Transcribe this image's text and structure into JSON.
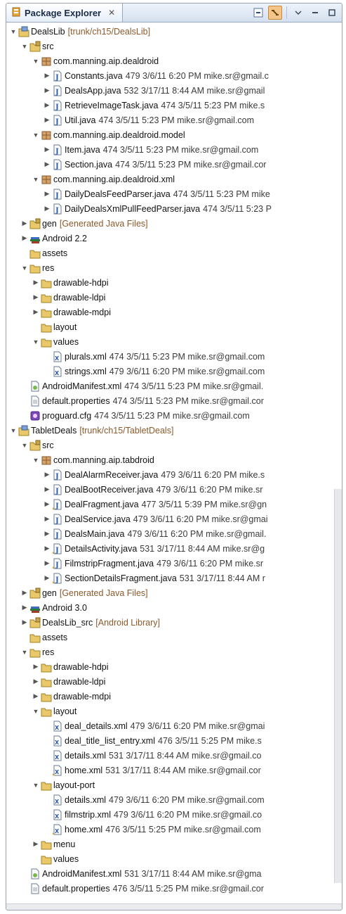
{
  "panel": {
    "title": "Package Explorer",
    "close_glyph": "✕",
    "toolbar": [
      "collapse-all-icon",
      "link-with-editor-icon",
      "view-menu-icon",
      "minimize-icon",
      "maximize-icon"
    ]
  },
  "tree": [
    {
      "d": 0,
      "a": "open",
      "icon": "project",
      "name": "DealsLib",
      "dec": "[trunk/ch15/DealsLib]",
      "decColor": "brown"
    },
    {
      "d": 1,
      "a": "open",
      "icon": "srcfolder",
      "name": "src",
      "dec": ""
    },
    {
      "d": 2,
      "a": "open",
      "icon": "package",
      "name": "com.manning.aip.dealdroid",
      "dec": ""
    },
    {
      "d": 3,
      "a": "closed",
      "icon": "java",
      "name": "Constants.java",
      "dec": "479  3/6/11 6:20 PM  mike.sr@gmail.c"
    },
    {
      "d": 3,
      "a": "closed",
      "icon": "java",
      "name": "DealsApp.java",
      "dec": "532  3/17/11 8:44 AM  mike.sr@gmail"
    },
    {
      "d": 3,
      "a": "closed",
      "icon": "java",
      "name": "RetrieveImageTask.java",
      "dec": "474  3/5/11 5:23 PM  mike.s"
    },
    {
      "d": 3,
      "a": "closed",
      "icon": "java",
      "name": "Util.java",
      "dec": "474  3/5/11 5:23 PM  mike.sr@gmail.com"
    },
    {
      "d": 2,
      "a": "open",
      "icon": "package",
      "name": "com.manning.aip.dealdroid.model",
      "dec": ""
    },
    {
      "d": 3,
      "a": "closed",
      "icon": "java",
      "name": "Item.java",
      "dec": "474  3/5/11 5:23 PM  mike.sr@gmail.com"
    },
    {
      "d": 3,
      "a": "closed",
      "icon": "java",
      "name": "Section.java",
      "dec": "474  3/5/11 5:23 PM  mike.sr@gmail.cor"
    },
    {
      "d": 2,
      "a": "open",
      "icon": "package",
      "name": "com.manning.aip.dealdroid.xml",
      "dec": ""
    },
    {
      "d": 3,
      "a": "closed",
      "icon": "java",
      "name": "DailyDealsFeedParser.java",
      "dec": "474  3/5/11 5:23 PM  mike"
    },
    {
      "d": 3,
      "a": "closed",
      "icon": "java",
      "name": "DailyDealsXmlPullFeedParser.java",
      "dec": "474  3/5/11 5:23 P"
    },
    {
      "d": 1,
      "a": "closed",
      "icon": "srcfolder",
      "name": "gen",
      "dec": "[Generated Java Files]",
      "decColor": "brown"
    },
    {
      "d": 1,
      "a": "closed",
      "icon": "library",
      "name": "Android 2.2",
      "dec": ""
    },
    {
      "d": 1,
      "a": "none",
      "icon": "folder",
      "name": "assets",
      "dec": ""
    },
    {
      "d": 1,
      "a": "open",
      "icon": "folder",
      "name": "res",
      "dec": ""
    },
    {
      "d": 2,
      "a": "closed",
      "icon": "folder",
      "name": "drawable-hdpi",
      "dec": ""
    },
    {
      "d": 2,
      "a": "closed",
      "icon": "folder",
      "name": "drawable-ldpi",
      "dec": ""
    },
    {
      "d": 2,
      "a": "closed",
      "icon": "folder",
      "name": "drawable-mdpi",
      "dec": ""
    },
    {
      "d": 2,
      "a": "none",
      "icon": "folder",
      "name": "layout",
      "dec": ""
    },
    {
      "d": 2,
      "a": "open",
      "icon": "folder",
      "name": "values",
      "dec": ""
    },
    {
      "d": 3,
      "a": "none",
      "icon": "xml",
      "name": "plurals.xml",
      "dec": "474  3/5/11 5:23 PM  mike.sr@gmail.com"
    },
    {
      "d": 3,
      "a": "none",
      "icon": "xml",
      "name": "strings.xml",
      "dec": "479  3/6/11 6:20 PM  mike.sr@gmail.com"
    },
    {
      "d": 1,
      "a": "none",
      "icon": "manifest",
      "name": "AndroidManifest.xml",
      "dec": "474  3/5/11 5:23 PM  mike.sr@gmail."
    },
    {
      "d": 1,
      "a": "none",
      "icon": "file",
      "name": "default.properties",
      "dec": "474  3/5/11 5:23 PM  mike.sr@gmail.cor"
    },
    {
      "d": 1,
      "a": "none",
      "icon": "proguard",
      "name": "proguard.cfg",
      "dec": "474  3/5/11 5:23 PM  mike.sr@gmail.com"
    },
    {
      "d": 0,
      "a": "open",
      "icon": "project",
      "name": "TabletDeals",
      "dec": "[trunk/ch15/TabletDeals]",
      "decColor": "brown"
    },
    {
      "d": 1,
      "a": "open",
      "icon": "srcfolder",
      "name": "src",
      "dec": ""
    },
    {
      "d": 2,
      "a": "open",
      "icon": "package",
      "name": "com.manning.aip.tabdroid",
      "dec": ""
    },
    {
      "d": 3,
      "a": "closed",
      "icon": "java",
      "name": "DealAlarmReceiver.java",
      "dec": "479  3/6/11 6:20 PM  mike.s"
    },
    {
      "d": 3,
      "a": "closed",
      "icon": "java",
      "name": "DealBootReceiver.java",
      "dec": "479  3/6/11 6:20 PM  mike.sr"
    },
    {
      "d": 3,
      "a": "closed",
      "icon": "javaw",
      "name": "DealFragment.java",
      "dec": "477  3/5/11 5:39 PM  mike.sr@gn"
    },
    {
      "d": 3,
      "a": "closed",
      "icon": "java",
      "name": "DealService.java",
      "dec": "479  3/6/11 6:20 PM  mike.sr@gmai"
    },
    {
      "d": 3,
      "a": "closed",
      "icon": "java",
      "name": "DealsMain.java",
      "dec": "479  3/6/11 6:20 PM  mike.sr@gmail."
    },
    {
      "d": 3,
      "a": "closed",
      "icon": "javaw",
      "name": "DetailsActivity.java",
      "dec": "531  3/17/11 8:44 AM  mike.sr@g"
    },
    {
      "d": 3,
      "a": "closed",
      "icon": "javaw",
      "name": "FilmstripFragment.java",
      "dec": "479  3/6/11 6:20 PM  mike.sr"
    },
    {
      "d": 3,
      "a": "closed",
      "icon": "javaw",
      "name": "SectionDetailsFragment.java",
      "dec": "531  3/17/11 8:44 AM  r"
    },
    {
      "d": 1,
      "a": "closed",
      "icon": "srcfolder",
      "name": "gen",
      "dec": "[Generated Java Files]",
      "decColor": "brown"
    },
    {
      "d": 1,
      "a": "closed",
      "icon": "library",
      "name": "Android 3.0",
      "dec": ""
    },
    {
      "d": 1,
      "a": "closed",
      "icon": "srcfolder",
      "name": "DealsLib_src",
      "dec": "[Android Library]",
      "decColor": "brown"
    },
    {
      "d": 1,
      "a": "none",
      "icon": "folder",
      "name": "assets",
      "dec": ""
    },
    {
      "d": 1,
      "a": "open",
      "icon": "folder",
      "name": "res",
      "dec": ""
    },
    {
      "d": 2,
      "a": "closed",
      "icon": "folder",
      "name": "drawable-hdpi",
      "dec": ""
    },
    {
      "d": 2,
      "a": "closed",
      "icon": "folder",
      "name": "drawable-ldpi",
      "dec": ""
    },
    {
      "d": 2,
      "a": "closed",
      "icon": "folder",
      "name": "drawable-mdpi",
      "dec": ""
    },
    {
      "d": 2,
      "a": "open",
      "icon": "folder",
      "name": "layout",
      "dec": ""
    },
    {
      "d": 3,
      "a": "none",
      "icon": "xml",
      "name": "deal_details.xml",
      "dec": "479  3/6/11 6:20 PM  mike.sr@gmai"
    },
    {
      "d": 3,
      "a": "none",
      "icon": "xml",
      "name": "deal_title_list_entry.xml",
      "dec": "476  3/5/11 5:25 PM  mike.s"
    },
    {
      "d": 3,
      "a": "none",
      "icon": "xml",
      "name": "details.xml",
      "dec": "531  3/17/11 8:44 AM  mike.sr@gmail.co"
    },
    {
      "d": 3,
      "a": "none",
      "icon": "xmlw",
      "name": "home.xml",
      "dec": "531  3/17/11 8:44 AM  mike.sr@gmail.cor"
    },
    {
      "d": 2,
      "a": "open",
      "icon": "folder",
      "name": "layout-port",
      "dec": ""
    },
    {
      "d": 3,
      "a": "none",
      "icon": "xml",
      "name": "details.xml",
      "dec": "479  3/6/11 6:20 PM  mike.sr@gmail.com"
    },
    {
      "d": 3,
      "a": "none",
      "icon": "xml",
      "name": "filmstrip.xml",
      "dec": "479  3/6/11 6:20 PM  mike.sr@gmail.co"
    },
    {
      "d": 3,
      "a": "none",
      "icon": "xmlw",
      "name": "home.xml",
      "dec": "476  3/5/11 5:25 PM  mike.sr@gmail.com"
    },
    {
      "d": 2,
      "a": "closed",
      "icon": "folder",
      "name": "menu",
      "dec": ""
    },
    {
      "d": 2,
      "a": "none",
      "icon": "folder",
      "name": "values",
      "dec": ""
    },
    {
      "d": 1,
      "a": "none",
      "icon": "manifest",
      "name": "AndroidManifest.xml",
      "dec": "531  3/17/11 8:44 AM  mike.sr@gma"
    },
    {
      "d": 1,
      "a": "none",
      "icon": "file",
      "name": "default.properties",
      "dec": "476  3/5/11 5:25 PM  mike.sr@gmail.cor"
    }
  ]
}
